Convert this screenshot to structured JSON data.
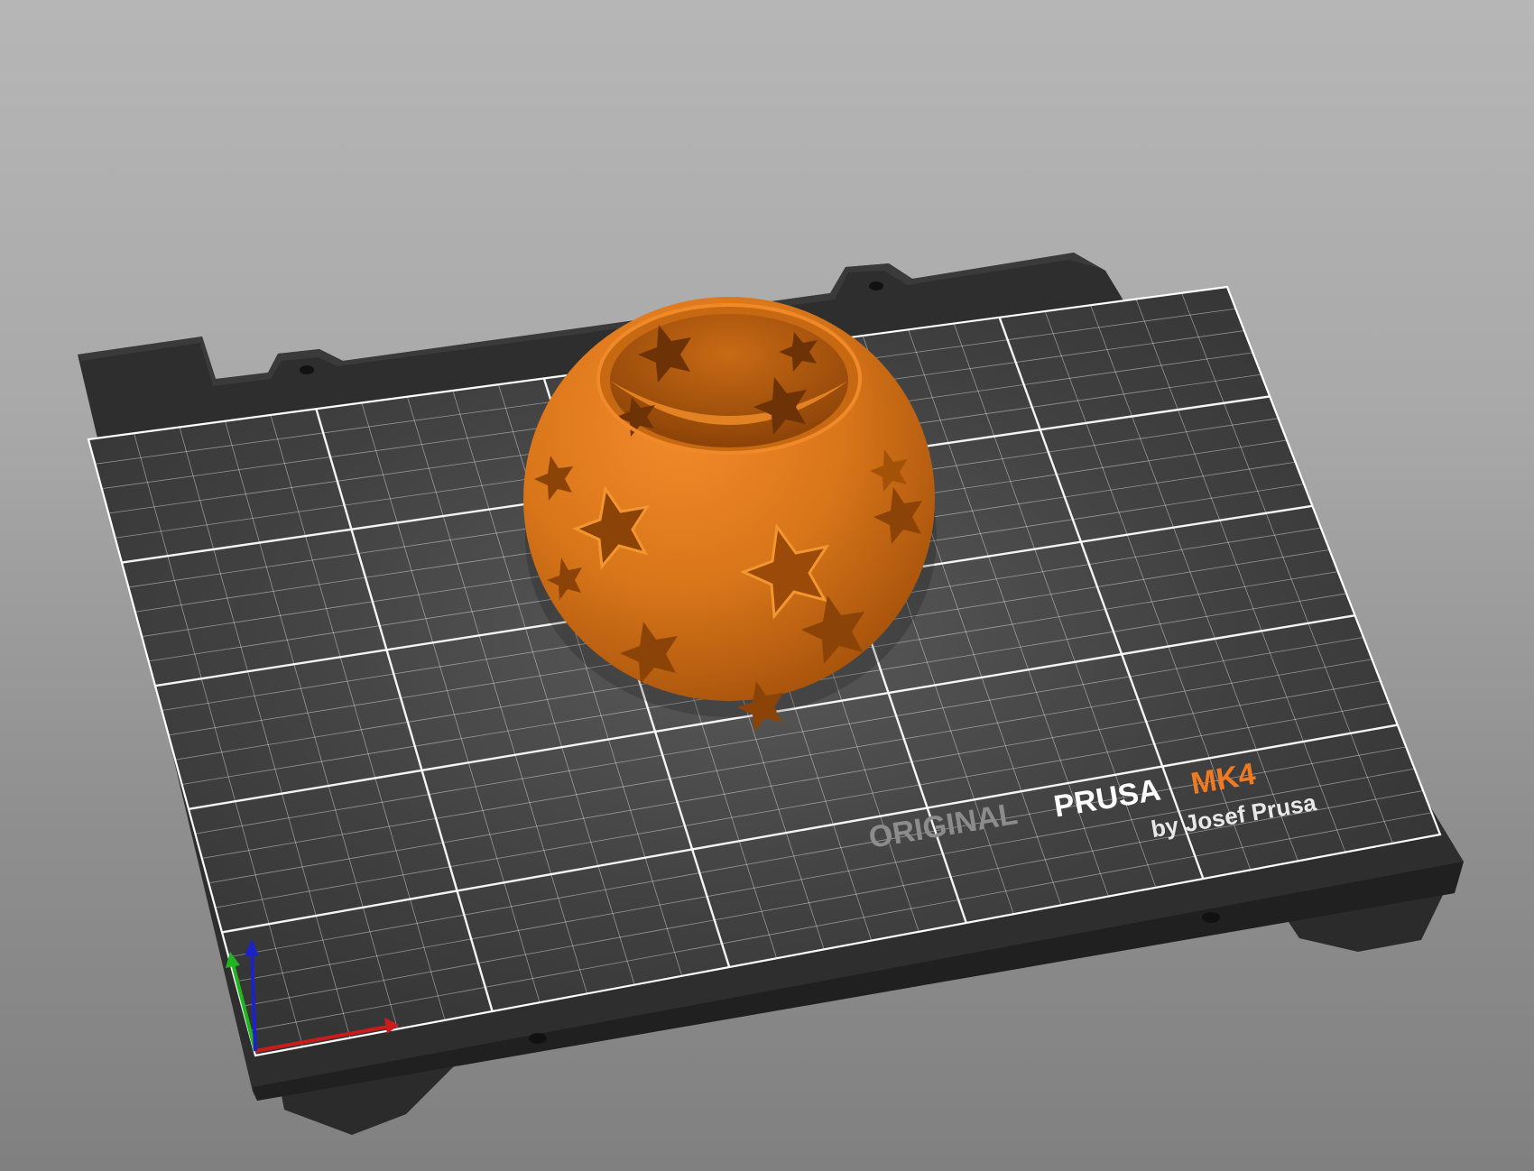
{
  "viewport": {
    "background_top": "#b6b6b6",
    "background_bottom": "#808080"
  },
  "bed": {
    "brand_original": "ORIGINAL",
    "brand_prusa": "PRUSA",
    "brand_model": "MK4",
    "brand_byline": "by Josef Prusa",
    "plate_color": "#2f2f2f",
    "surface_color": "#3b3b3b",
    "grid_color": "#ffffff",
    "accent_color": "#f07a22"
  },
  "model": {
    "name_icon": "star-sphere-vase-model",
    "color": "#e07b1a",
    "shadow_color": "#8a3f06"
  },
  "axes": {
    "x_color": "#cc1b1b",
    "y_color": "#22b522",
    "z_color": "#1b23c8"
  }
}
